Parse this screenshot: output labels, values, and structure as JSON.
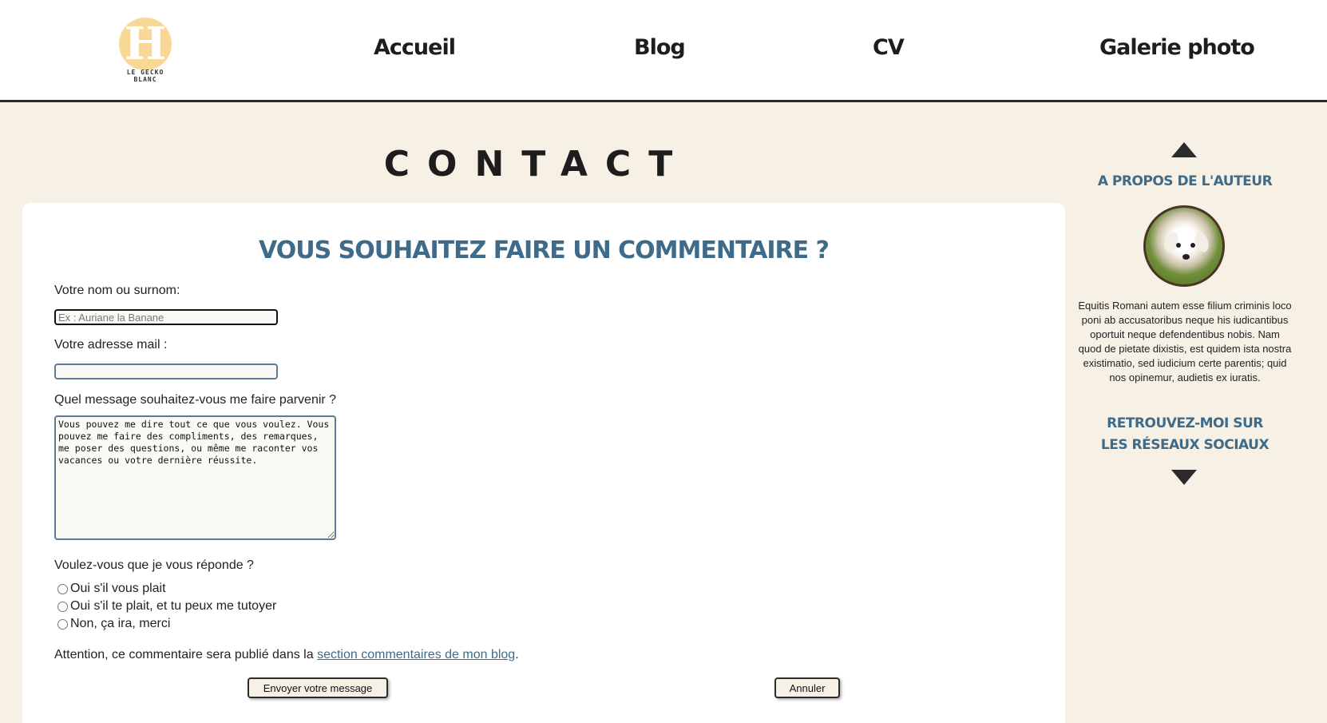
{
  "header": {
    "logo_letter": "H",
    "logo_text": "LE GECKO BLANC",
    "nav": [
      {
        "label": "Accueil"
      },
      {
        "label": "Blog"
      },
      {
        "label": "CV"
      },
      {
        "label": "Galerie photo"
      }
    ]
  },
  "page": {
    "title": "CONTACT"
  },
  "form": {
    "heading": "VOUS SOUHAITEZ FAIRE UN COMMENTAIRE ?",
    "name_label": "Votre nom ou surnom:",
    "name_placeholder": "Ex : Auriane la Banane",
    "email_label": "Votre adresse mail :",
    "email_placeholder": "",
    "message_label": "Quel message souhaitez-vous me faire parvenir ?",
    "message_value": "Vous pouvez me dire tout ce que vous voulez. Vous pouvez me faire des compliments, des remarques, me poser des questions, ou même me raconter vos vacances ou votre dernière réussite.",
    "reply_label": "Voulez-vous que je vous réponde ?",
    "reply_options": [
      {
        "label": "Oui s'il vous plait"
      },
      {
        "label": "Oui s'il te plait, et tu peux me tutoyer"
      },
      {
        "label": "Non, ça ira, merci"
      }
    ],
    "notice_text": "Attention, ce commentaire sera publié dans la ",
    "notice_link": "section commentaires de mon blog",
    "notice_end": ".",
    "submit_label": "Envoyer votre message",
    "cancel_label": "Annuler"
  },
  "sidebar": {
    "about_heading": "A PROPOS DE L'AUTEUR",
    "bio": "Equitis Romani autem esse filium criminis loco poni ab accusatoribus neque his iudicantibus oportuit neque defendentibus nobis. Nam quod de pietate dixistis, est quidem ista nostra existimatio, sed iudicium certe parentis; quid nos opinemur, audietis ex iuratis.",
    "social_heading": "RETROUVEZ-MOI SUR LES RÉSEAUX SOCIAUX"
  },
  "colors": {
    "background": "#f7f0e5",
    "accent": "#3f6b8a",
    "logo": "#f8d896"
  }
}
